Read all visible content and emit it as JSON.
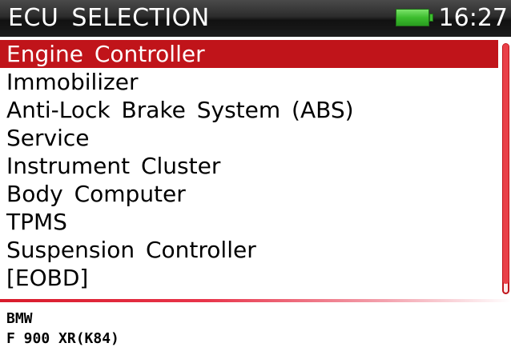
{
  "header": {
    "title": "ECU SELECTION",
    "time": "16:27",
    "battery_icon": "battery-full-icon",
    "battery_level": 1.0,
    "battery_color": "#3cbd2e"
  },
  "ecu_list": {
    "selected_index": 0,
    "items": [
      {
        "label": "Engine Controller"
      },
      {
        "label": "Immobilizer"
      },
      {
        "label": "Anti-Lock Brake System (ABS)"
      },
      {
        "label": "Service"
      },
      {
        "label": "Instrument Cluster"
      },
      {
        "label": "Body Computer"
      },
      {
        "label": "TPMS"
      },
      {
        "label": "Suspension Controller"
      },
      {
        "label": "[EOBD]"
      }
    ]
  },
  "vehicle": {
    "make": "BMW",
    "model": "F 900 XR(K84)"
  },
  "colors": {
    "selection": "#c0141a",
    "accent": "#e94048"
  }
}
